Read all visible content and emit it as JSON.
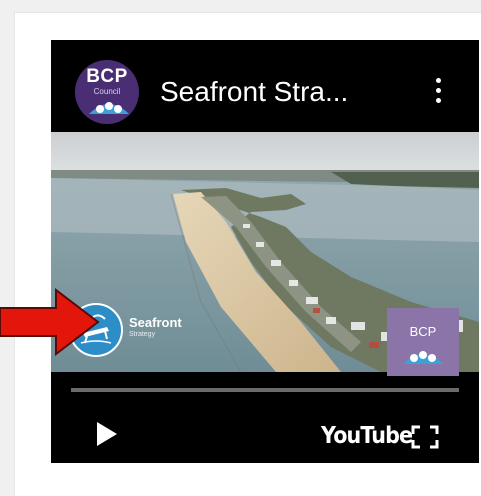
{
  "card": {
    "video": {
      "channel_logo": {
        "line1": "BCP",
        "line2": "Council"
      },
      "title": "Seafront Stra...",
      "more_icon": "more-vert-icon",
      "watermark": {
        "title": "Seafront",
        "subtitle": "Strategy"
      },
      "corner_logo": {
        "text": "BCP"
      },
      "controls": {
        "play_icon": "play-icon",
        "youtube_label": "YouTube",
        "fullscreen_icon": "fullscreen-icon"
      }
    }
  },
  "annotation": {
    "arrow_icon": "red-arrow-icon",
    "color": "#e3160c"
  },
  "colors": {
    "channel": "#4a2e73",
    "player_bg": "#000000"
  }
}
